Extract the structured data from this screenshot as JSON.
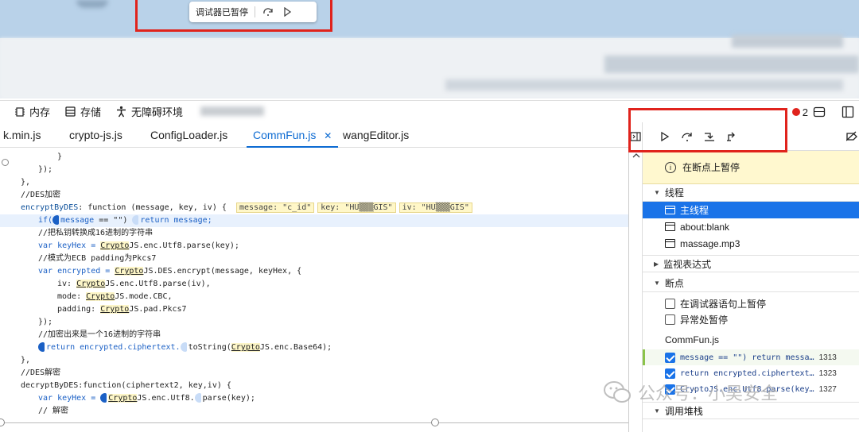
{
  "browser": {
    "paused_label": "调试器已暂停"
  },
  "toolbar": {
    "memory": "内存",
    "storage": "存储",
    "accessibility": "无障碍环境",
    "error_count": "2"
  },
  "tabs": [
    "k.min.js",
    "crypto-js.js",
    "ConfigLoader.js",
    "CommFun.js",
    "wangEditor.js"
  ],
  "code": {
    "l1": "}",
    "l2": "});",
    "l3": "},",
    "l4": "//DES加密",
    "l5a": "encryptByDES",
    "l5b": ": function (message, key, iv) {",
    "l5c": "message: \"c_id\"",
    "l5d": "key: \"HU▒▒▒GIS\"",
    "l5e": "iv: \"HU▒▒▒GIS\"",
    "l6a": "if(",
    "l6b": "message",
    "l6c": " == \"\") ",
    "l6d": "return message;",
    "l7": "//把私钥转换成16进制的字符串",
    "l8a": "var keyHex = ",
    "l8b": "Crypto",
    "l8c": "JS.enc.Utf8.parse(key);",
    "l9": "//模式为ECB padding为Pkcs7",
    "l10a": "var encrypted = ",
    "l10b": "Crypto",
    "l10c": "JS.DES.encrypt(message, keyHex, {",
    "l11a": "iv: ",
    "l11b": "Crypto",
    "l11c": "JS.enc.Utf8.parse(iv),",
    "l12a": "mode: ",
    "l12b": "Crypto",
    "l12c": "JS.mode.CBC,",
    "l13a": "padding: ",
    "l13b": "Crypto",
    "l13c": "JS.pad.Pkcs7",
    "l14": "});",
    "l15": "//加密出来是一个16进制的字符串",
    "l16a": "return encrypted.ciphertext.",
    "l16b": "toString(",
    "l16c": "Crypto",
    "l16d": "JS.enc.Base64);",
    "l17": "},",
    "l18": "//DES解密",
    "l19": "decryptByDES:function(ciphertext2, key,iv) {",
    "l20a": "var keyHex = ",
    "l20b": "Crypto",
    "l20c": "JS.enc.Utf8.",
    "l20d": "parse(key);",
    "l21": "// 解密"
  },
  "pane": {
    "paused_banner": "在断点上暂停",
    "threads_title": "线程",
    "threads": [
      "主线程",
      "about:blank",
      "massage.mp3"
    ],
    "watch_title": "监视表达式",
    "breakpoints_title": "断点",
    "pause_on_debugger": "在调试器语句上暂停",
    "pause_on_exceptions": "异常处暂停",
    "bp_file": "CommFun.js",
    "breakpoints": [
      {
        "text": "message == \"\") return messa…",
        "line": "1313"
      },
      {
        "text": "return encrypted.ciphertext…",
        "line": "1323"
      },
      {
        "text": "CryptoJS.enc.Utf8.parse(key…",
        "line": "1327"
      }
    ],
    "callstack_title": "调用堆栈"
  },
  "watermark": "公众号：小吴安全",
  "colors": {
    "accent": "#1a73e8",
    "highlight_box": "#e0231c",
    "paused_banner": "#fff8cf"
  }
}
